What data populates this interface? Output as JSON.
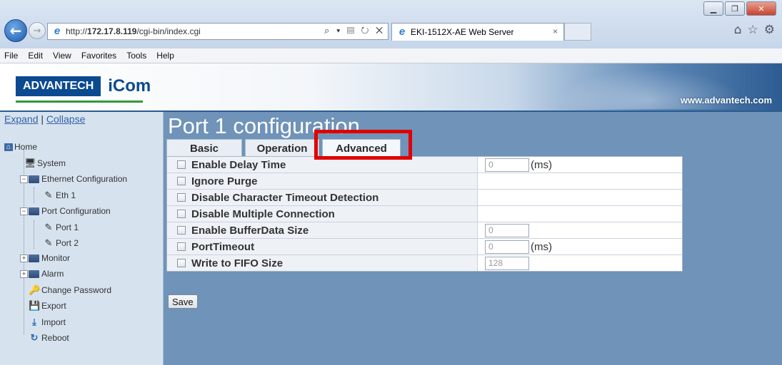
{
  "browser": {
    "url_prefix": "http://",
    "url_host": "172.17.8.119",
    "url_path": "/cgi-bin/index.cgi",
    "address_tools": "⌕ ▾ ▤ ↻ ✕",
    "tab_title": "EKI-1512X-AE Web Server",
    "tab_close": "×",
    "icons": [
      "back-icon",
      "forward-icon",
      "home-icon",
      "favorites-star-icon",
      "settings-gear-icon"
    ]
  },
  "menu": [
    "File",
    "Edit",
    "View",
    "Favorites",
    "Tools",
    "Help"
  ],
  "banner": {
    "logo_brand": "ADVANTECH",
    "logo_product": "iCom",
    "site_url": "www.advantech.com"
  },
  "sidebar": {
    "expand": "Expand",
    "separator": "|",
    "collapse": "Collapse",
    "tree": {
      "home": "Home",
      "system": "System",
      "ethernet": "Ethernet Configuration",
      "eth1": "Eth 1",
      "port_config": "Port Configuration",
      "port1": "Port 1",
      "port2": "Port 2",
      "monitor": "Monitor",
      "alarm": "Alarm",
      "change_password": "Change Password",
      "export": "Export",
      "import": "Import",
      "reboot": "Reboot"
    }
  },
  "main": {
    "title": "Port 1 configuration",
    "tabs": {
      "basic": "Basic",
      "operation": "Operation",
      "advanced": "Advanced",
      "active": "Advanced"
    },
    "rows": [
      {
        "label": "Enable Delay Time",
        "value": "0",
        "unit": "(ms)",
        "has_input": true
      },
      {
        "label": "Ignore Purge",
        "has_input": false
      },
      {
        "label": "Disable Character Timeout Detection",
        "has_input": false
      },
      {
        "label": "Disable Multiple Connection",
        "has_input": false
      },
      {
        "label": "Enable BufferData Size",
        "value": "0",
        "unit": "",
        "has_input": true
      },
      {
        "label": "PortTimeout",
        "value": "0",
        "unit": "(ms)",
        "has_input": true
      },
      {
        "label": "Write to FIFO Size",
        "value": "128",
        "unit": "",
        "has_input": true
      }
    ],
    "save_label": "Save"
  },
  "colors": {
    "sidebar_bg": "#d6e3ef",
    "main_bg": "#6f93b9",
    "highlight": "#e00000"
  }
}
